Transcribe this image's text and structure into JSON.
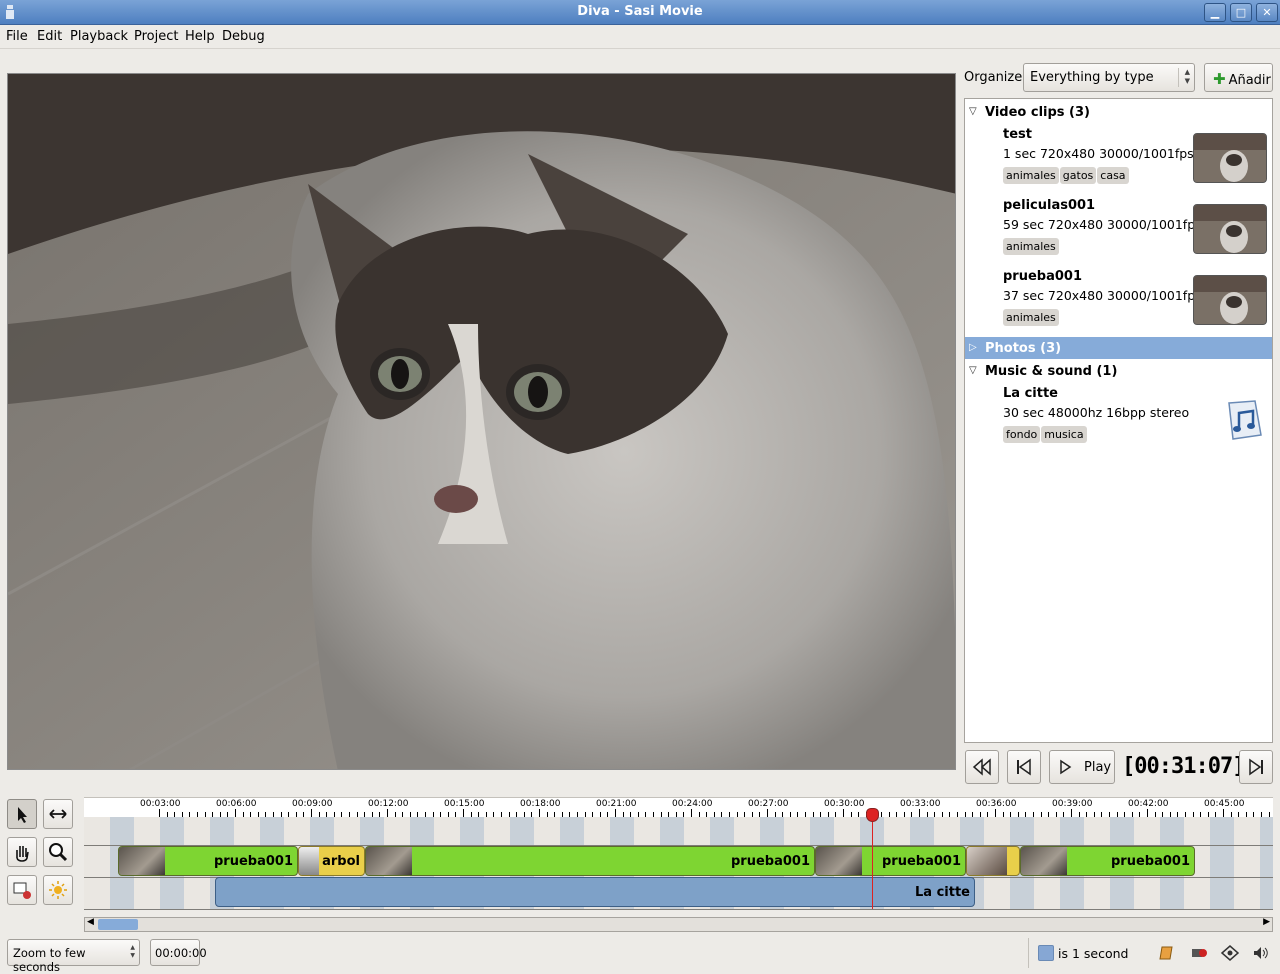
{
  "window": {
    "title": "Diva - Sasi Movie"
  },
  "menu": [
    "File",
    "Edit",
    "Playback",
    "Project",
    "Help",
    "Debug"
  ],
  "organize": {
    "label": "Organize",
    "selected": "Everything by type",
    "add_label": "Añadir"
  },
  "library": {
    "video_header": "Video clips (3)",
    "photos_header": "Photos (3)",
    "music_header": "Music & sound (1)",
    "videos": [
      {
        "name": "test",
        "info": "1 sec 720x480 30000/1001fps",
        "tags": [
          "animales",
          "gatos",
          "casa"
        ]
      },
      {
        "name": "peliculas001",
        "info": "59 sec 720x480 30000/1001fps",
        "tags": [
          "animales"
        ]
      },
      {
        "name": "prueba001",
        "info": "37 sec 720x480 30000/1001fps",
        "tags": [
          "animales"
        ]
      }
    ],
    "music": [
      {
        "name": "La citte",
        "info": "30 sec 48000hz 16bpp stereo",
        "tags": [
          "fondo",
          "musica"
        ]
      }
    ]
  },
  "transport": {
    "play_label": "Play",
    "timecode": "[00:31:07]"
  },
  "ruler": [
    "00:03:00",
    "00:06:00",
    "00:09:00",
    "00:12:00",
    "00:15:00",
    "00:18:00",
    "00:21:00",
    "00:24:00",
    "00:27:00",
    "00:30:00",
    "00:33:00",
    "00:36:00",
    "00:39:00",
    "00:42:00",
    "00:45:00"
  ],
  "timeline": {
    "clip1": "prueba001",
    "clip2": "arbol",
    "clip3": "prueba001",
    "clip4": "prueba001",
    "clip5": "prueba001",
    "audio1": "La citte"
  },
  "bottom": {
    "zoom": "Zoom to few seconds",
    "time": "00:00:00",
    "scale": "is 1 second"
  },
  "colors": {
    "selection": "#86abd9",
    "video_clip": "#7ed532",
    "image_clip": "#e9cf4a",
    "audio_clip": "#7ea1c8",
    "playhead": "#dd2222"
  }
}
